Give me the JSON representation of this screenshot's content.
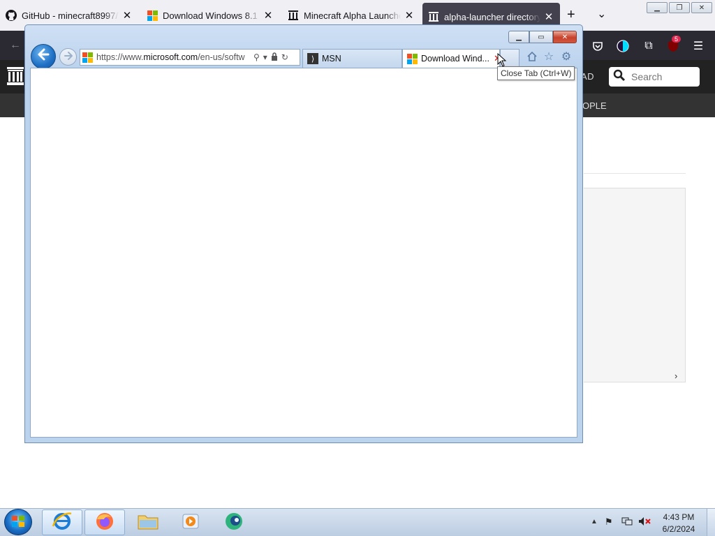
{
  "firefox": {
    "tabs": [
      {
        "title": "GitHub - minecraft8997/Te",
        "icon": "github-icon"
      },
      {
        "title": "Download Windows 8.1 Di",
        "icon": "microsoft-logo-icon"
      },
      {
        "title": "Minecraft Alpha Launcher",
        "icon": "archive-icon"
      },
      {
        "title": "alpha-launcher directory li",
        "icon": "archive-icon",
        "active": true
      }
    ],
    "extension_badge": "5"
  },
  "site": {
    "upload_label": "AD",
    "search_placeholder": "Search",
    "nav_people": "OPLE"
  },
  "ie": {
    "url_prefix": "https://www.",
    "url_domain": "microsoft.com",
    "url_rest": "/en-us/softw",
    "tabs": [
      {
        "title": "MSN",
        "icon": "msn-icon"
      },
      {
        "title": "Download Wind...",
        "icon": "microsoft-logo-icon",
        "active": true
      }
    ],
    "tooltip": "Close Tab (Ctrl+W)"
  },
  "taskbar": {
    "time": "4:43 PM",
    "date": "6/2/2024"
  },
  "colors": {
    "ff_dark": "#2b2a33",
    "ff_active_tab": "#42414d",
    "ie_frame": "#bcd3ee",
    "ie_back_button": "#1e6fc4",
    "close_red": "#c7412b"
  }
}
